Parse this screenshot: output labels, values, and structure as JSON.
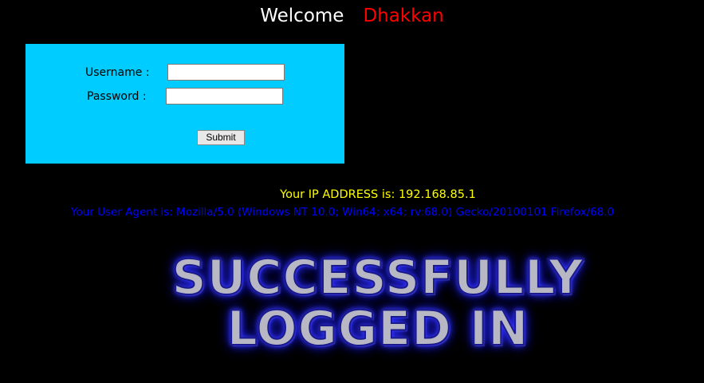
{
  "header": {
    "welcome_text": "Welcome",
    "user_name": "Dhakkan"
  },
  "login_form": {
    "username_label": "Username :",
    "username_value": "",
    "password_label": "Password :",
    "password_value": "",
    "submit_label": "Submit"
  },
  "info": {
    "ip_text": "Your IP ADDRESS is: 192.168.85.1",
    "user_agent_text": "Your User Agent is: Mozilla/5.0 (Windows NT 10.0; Win64; x64; rv:68.0) Gecko/20100101 Firefox/68.0"
  },
  "result": {
    "line1": "SUCCESSFULLY",
    "line2": "LOGGED IN"
  },
  "colors": {
    "background": "#000000",
    "form_background": "#00ccff",
    "name_color": "#ff0000",
    "ip_color": "#ffff00",
    "user_agent_color": "#0000ff"
  }
}
